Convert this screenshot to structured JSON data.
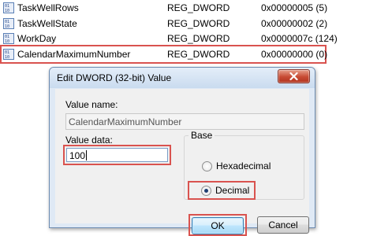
{
  "registry": {
    "rows": [
      {
        "name": "TaskWellRows",
        "type": "REG_DWORD",
        "data": "0x00000005 (5)"
      },
      {
        "name": "TaskWellState",
        "type": "REG_DWORD",
        "data": "0x00000002 (2)"
      },
      {
        "name": "WorkDay",
        "type": "REG_DWORD",
        "data": "0x0000007c (124)"
      },
      {
        "name": "CalendarMaximumNumber",
        "type": "REG_DWORD",
        "data": "0x00000000 (0)"
      }
    ],
    "selected_index": 3,
    "icon": "registry-value-icon"
  },
  "dialog": {
    "title": "Edit DWORD (32-bit) Value",
    "close_icon": "close-icon",
    "value_name_label": "Value name:",
    "value_name": "CalendarMaximumNumber",
    "value_data_label": "Value data:",
    "value_data": "100",
    "base_label": "Base",
    "base_options": [
      {
        "label": "Hexadecimal",
        "selected": false
      },
      {
        "label": "Decimal",
        "selected": true
      }
    ],
    "ok_label": "OK",
    "cancel_label": "Cancel"
  },
  "colors": {
    "highlight": "#d9534f",
    "dialog_frame": "#dfe9f5",
    "close_button": "#c74a33"
  }
}
